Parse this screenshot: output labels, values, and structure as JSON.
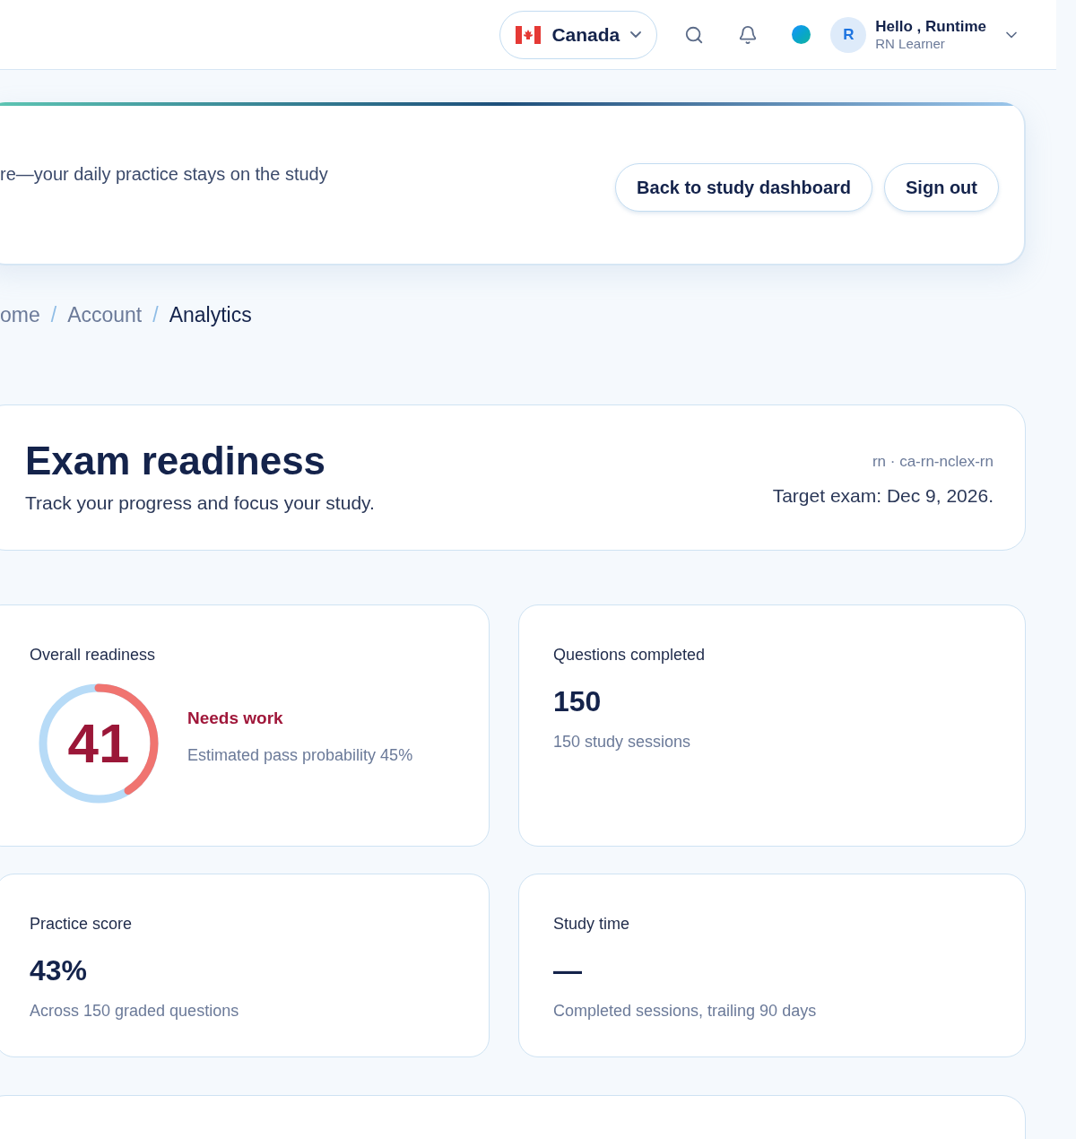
{
  "header": {
    "country": "Canada",
    "greeting": "Hello , Runtime",
    "role": "RN Learner",
    "avatar_initial": "R"
  },
  "hero": {
    "subtitle": "re—your daily practice stays on the study",
    "buttons": [
      "Back to study dashboard",
      "Sign out"
    ]
  },
  "breadcrumb": [
    {
      "label": "ome",
      "selected": false
    },
    {
      "separator": "/",
      "label": "Account",
      "selected": false
    },
    {
      "separator": "/",
      "label": "Analytics",
      "selected": true
    }
  ],
  "readiness": {
    "title": "Exam readiness",
    "subtitle": "Track your progress and focus your study.",
    "code": "rn · ca-rn-nclex-rn",
    "target": "Target exam: Dec 9, 2026."
  },
  "overall": {
    "label": "Overall readiness",
    "score": "41",
    "level": 0.41,
    "status": "Needs work",
    "detail": "Estimated pass probability 45%"
  },
  "stats": [
    {
      "label": "Questions completed",
      "value": "150",
      "note": "150 study sessions"
    },
    {
      "label": "Practice score",
      "value": "43%",
      "note": "Across 150 graded questions"
    },
    {
      "label": "Study time",
      "value": "—",
      "note": "Completed sessions, trailing 90 days"
    }
  ]
}
